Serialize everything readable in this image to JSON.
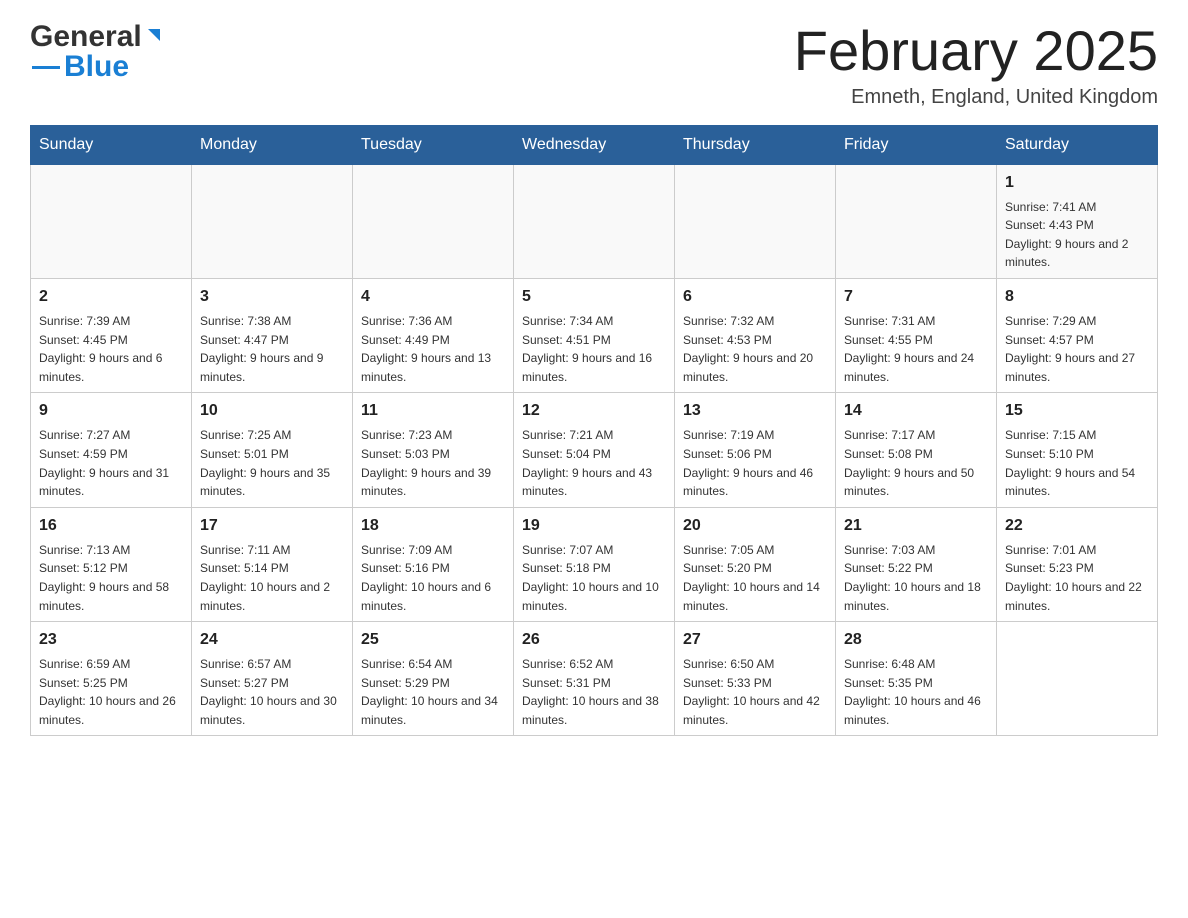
{
  "header": {
    "logo_general": "General",
    "logo_blue": "Blue",
    "month_title": "February 2025",
    "location": "Emneth, England, United Kingdom"
  },
  "days_of_week": [
    "Sunday",
    "Monday",
    "Tuesday",
    "Wednesday",
    "Thursday",
    "Friday",
    "Saturday"
  ],
  "weeks": [
    [
      {
        "day": "",
        "info": ""
      },
      {
        "day": "",
        "info": ""
      },
      {
        "day": "",
        "info": ""
      },
      {
        "day": "",
        "info": ""
      },
      {
        "day": "",
        "info": ""
      },
      {
        "day": "",
        "info": ""
      },
      {
        "day": "1",
        "info": "Sunrise: 7:41 AM\nSunset: 4:43 PM\nDaylight: 9 hours and 2 minutes."
      }
    ],
    [
      {
        "day": "2",
        "info": "Sunrise: 7:39 AM\nSunset: 4:45 PM\nDaylight: 9 hours and 6 minutes."
      },
      {
        "day": "3",
        "info": "Sunrise: 7:38 AM\nSunset: 4:47 PM\nDaylight: 9 hours and 9 minutes."
      },
      {
        "day": "4",
        "info": "Sunrise: 7:36 AM\nSunset: 4:49 PM\nDaylight: 9 hours and 13 minutes."
      },
      {
        "day": "5",
        "info": "Sunrise: 7:34 AM\nSunset: 4:51 PM\nDaylight: 9 hours and 16 minutes."
      },
      {
        "day": "6",
        "info": "Sunrise: 7:32 AM\nSunset: 4:53 PM\nDaylight: 9 hours and 20 minutes."
      },
      {
        "day": "7",
        "info": "Sunrise: 7:31 AM\nSunset: 4:55 PM\nDaylight: 9 hours and 24 minutes."
      },
      {
        "day": "8",
        "info": "Sunrise: 7:29 AM\nSunset: 4:57 PM\nDaylight: 9 hours and 27 minutes."
      }
    ],
    [
      {
        "day": "9",
        "info": "Sunrise: 7:27 AM\nSunset: 4:59 PM\nDaylight: 9 hours and 31 minutes."
      },
      {
        "day": "10",
        "info": "Sunrise: 7:25 AM\nSunset: 5:01 PM\nDaylight: 9 hours and 35 minutes."
      },
      {
        "day": "11",
        "info": "Sunrise: 7:23 AM\nSunset: 5:03 PM\nDaylight: 9 hours and 39 minutes."
      },
      {
        "day": "12",
        "info": "Sunrise: 7:21 AM\nSunset: 5:04 PM\nDaylight: 9 hours and 43 minutes."
      },
      {
        "day": "13",
        "info": "Sunrise: 7:19 AM\nSunset: 5:06 PM\nDaylight: 9 hours and 46 minutes."
      },
      {
        "day": "14",
        "info": "Sunrise: 7:17 AM\nSunset: 5:08 PM\nDaylight: 9 hours and 50 minutes."
      },
      {
        "day": "15",
        "info": "Sunrise: 7:15 AM\nSunset: 5:10 PM\nDaylight: 9 hours and 54 minutes."
      }
    ],
    [
      {
        "day": "16",
        "info": "Sunrise: 7:13 AM\nSunset: 5:12 PM\nDaylight: 9 hours and 58 minutes."
      },
      {
        "day": "17",
        "info": "Sunrise: 7:11 AM\nSunset: 5:14 PM\nDaylight: 10 hours and 2 minutes."
      },
      {
        "day": "18",
        "info": "Sunrise: 7:09 AM\nSunset: 5:16 PM\nDaylight: 10 hours and 6 minutes."
      },
      {
        "day": "19",
        "info": "Sunrise: 7:07 AM\nSunset: 5:18 PM\nDaylight: 10 hours and 10 minutes."
      },
      {
        "day": "20",
        "info": "Sunrise: 7:05 AM\nSunset: 5:20 PM\nDaylight: 10 hours and 14 minutes."
      },
      {
        "day": "21",
        "info": "Sunrise: 7:03 AM\nSunset: 5:22 PM\nDaylight: 10 hours and 18 minutes."
      },
      {
        "day": "22",
        "info": "Sunrise: 7:01 AM\nSunset: 5:23 PM\nDaylight: 10 hours and 22 minutes."
      }
    ],
    [
      {
        "day": "23",
        "info": "Sunrise: 6:59 AM\nSunset: 5:25 PM\nDaylight: 10 hours and 26 minutes."
      },
      {
        "day": "24",
        "info": "Sunrise: 6:57 AM\nSunset: 5:27 PM\nDaylight: 10 hours and 30 minutes."
      },
      {
        "day": "25",
        "info": "Sunrise: 6:54 AM\nSunset: 5:29 PM\nDaylight: 10 hours and 34 minutes."
      },
      {
        "day": "26",
        "info": "Sunrise: 6:52 AM\nSunset: 5:31 PM\nDaylight: 10 hours and 38 minutes."
      },
      {
        "day": "27",
        "info": "Sunrise: 6:50 AM\nSunset: 5:33 PM\nDaylight: 10 hours and 42 minutes."
      },
      {
        "day": "28",
        "info": "Sunrise: 6:48 AM\nSunset: 5:35 PM\nDaylight: 10 hours and 46 minutes."
      },
      {
        "day": "",
        "info": ""
      }
    ]
  ]
}
